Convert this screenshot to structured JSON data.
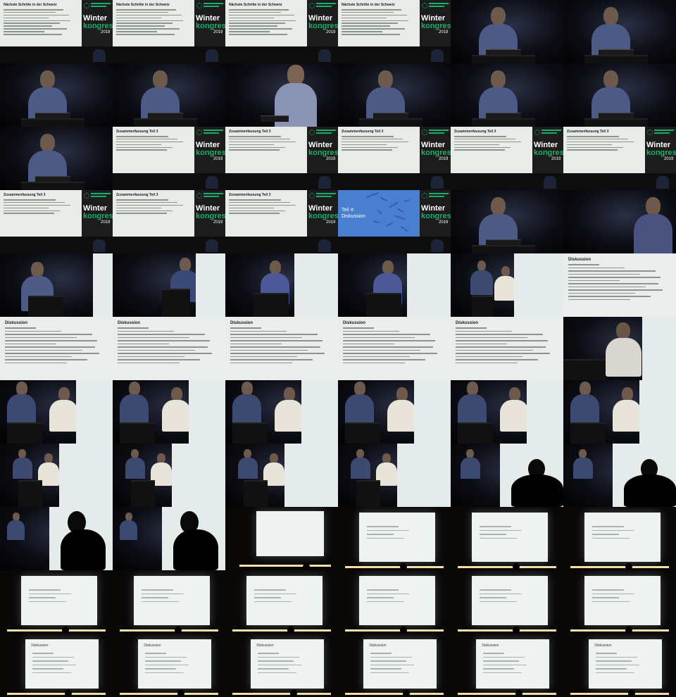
{
  "slide_texts": {
    "next_steps": "Nächste Schritte in der Schweiz",
    "summary": "Zusammenfassung Teil 3",
    "part4_line1": "Teil 4:",
    "part4_line2": "Diskussion",
    "discussion": "Diskussion",
    "brand_line1": "Winter",
    "brand_line2": "kongress",
    "brand_year": "2019"
  },
  "colors": {
    "brand_green": "#19b06a",
    "slide_bg": "#e7ece9",
    "blue_slide": "#4a7fd0",
    "background": "#000000"
  },
  "frames": [
    "slide-next_steps",
    "slide-next_steps",
    "slide-next_steps",
    "slide-next_steps",
    "speaker",
    "speaker",
    "speaker",
    "speaker",
    "speaker-gesture",
    "speaker",
    "speaker",
    "speaker",
    "speaker",
    "slide-summary",
    "slide-summary",
    "slide-summary",
    "slide-summary",
    "slide-summary",
    "slide-summary",
    "slide-summary",
    "slide-summary",
    "slide-part4",
    "speaker",
    "speaker-right",
    "stage-left",
    "stage-mic",
    "stage-mid",
    "stage-mid",
    "stage-two",
    "disc",
    "disc",
    "disc",
    "disc",
    "disc",
    "disc",
    "stage-close",
    "stage-two-close",
    "stage-two-close",
    "stage-two-close",
    "stage-two-close",
    "stage-two-close",
    "stage-two-close",
    "stage-two-wide",
    "stage-two-wide",
    "stage-two-wide",
    "stage-two-wide",
    "stage-sil",
    "stage-sil",
    "stage-sil-left",
    "stage-sil-left",
    "hall-side",
    "hall",
    "hall",
    "hall",
    "hall",
    "hall",
    "hall",
    "hall",
    "hall",
    "hall",
    "hall-disc",
    "hall-disc",
    "hall-disc",
    "hall-disc",
    "hall-disc",
    "hall-disc"
  ]
}
